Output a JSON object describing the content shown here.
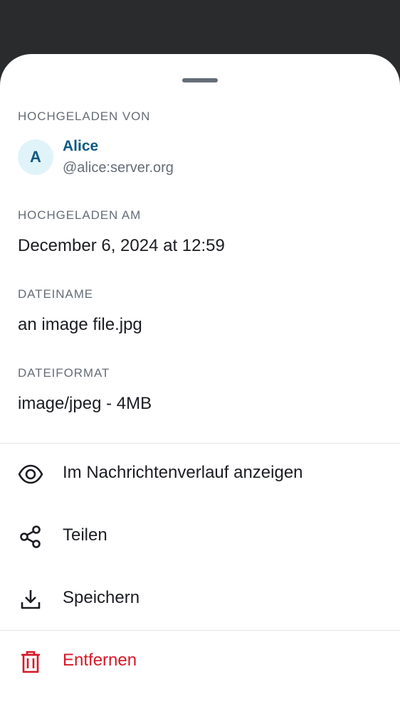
{
  "sheet": {
    "uploaded_by_label": "HOCHGELADEN VON",
    "user": {
      "avatar_letter": "A",
      "display_name": "Alice",
      "user_id": "@alice:server.org"
    },
    "uploaded_at_label": "HOCHGELADEN AM",
    "uploaded_at_value": "December 6, 2024 at 12:59",
    "filename_label": "DATEINAME",
    "filename_value": "an image file.jpg",
    "format_label": "DATEIFORMAT",
    "format_value": "image/jpeg - 4MB"
  },
  "actions": {
    "view_in_timeline": {
      "label": "Im Nachrichtenverlauf anzeigen",
      "icon": "eye-icon"
    },
    "share": {
      "label": "Teilen",
      "icon": "share-icon"
    },
    "save": {
      "label": "Speichern",
      "icon": "download-icon"
    },
    "remove": {
      "label": "Entfernen",
      "icon": "trash-icon"
    }
  },
  "colors": {
    "accent": "#0e5a82",
    "danger": "#d51928",
    "secondary_text": "#656d77",
    "primary_text": "#1b1d22",
    "backdrop": "#2a2b2d"
  }
}
